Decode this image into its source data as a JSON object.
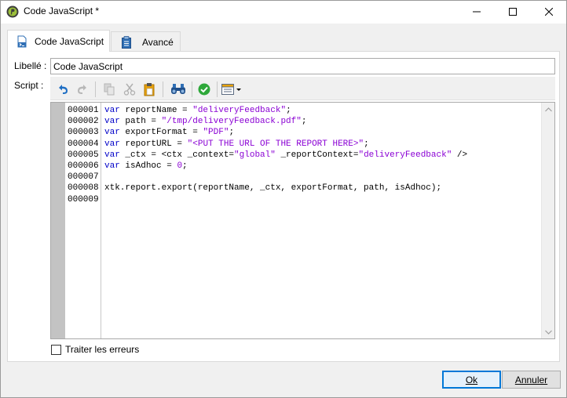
{
  "window": {
    "title": "Code JavaScript *"
  },
  "tabs": [
    {
      "label": "Code JavaScript",
      "icon": "script-icon",
      "active": true
    },
    {
      "label": "Avancé",
      "icon": "clipboard-icon",
      "active": false
    }
  ],
  "form": {
    "libelle_label": "Libellé :",
    "libelle_value": "Code JavaScript",
    "script_label": "Script :"
  },
  "toolbar": {
    "icons": [
      "undo-icon",
      "redo-icon",
      "copy-icon",
      "cut-icon",
      "paste-icon",
      "find-icon",
      "check-syntax-icon",
      "insert-field-icon"
    ]
  },
  "editor": {
    "line_numbers": [
      "000001",
      "000002",
      "000003",
      "000004",
      "000005",
      "000006",
      "000007",
      "000008",
      "000009"
    ],
    "lines": [
      [
        {
          "t": "var",
          "c": "kw"
        },
        {
          "t": " reportName = ",
          "c": "pl"
        },
        {
          "t": "\"deliveryFeedback\"",
          "c": "str"
        },
        {
          "t": ";",
          "c": "pl"
        }
      ],
      [
        {
          "t": "var",
          "c": "kw"
        },
        {
          "t": " path = ",
          "c": "pl"
        },
        {
          "t": "\"/tmp/deliveryFeedback.pdf\"",
          "c": "str"
        },
        {
          "t": ";",
          "c": "pl"
        }
      ],
      [
        {
          "t": "var",
          "c": "kw"
        },
        {
          "t": " exportFormat = ",
          "c": "pl"
        },
        {
          "t": "\"PDF\"",
          "c": "str"
        },
        {
          "t": ";",
          "c": "pl"
        }
      ],
      [
        {
          "t": "var",
          "c": "kw"
        },
        {
          "t": " reportURL = ",
          "c": "pl"
        },
        {
          "t": "\"<PUT THE URL OF THE REPORT HERE>\"",
          "c": "str"
        },
        {
          "t": ";",
          "c": "pl"
        }
      ],
      [
        {
          "t": "var",
          "c": "kw"
        },
        {
          "t": " _ctx = <ctx _context=",
          "c": "pl"
        },
        {
          "t": "\"global\"",
          "c": "str"
        },
        {
          "t": " _reportContext=",
          "c": "pl"
        },
        {
          "t": "\"deliveryFeedback\"",
          "c": "str"
        },
        {
          "t": " />",
          "c": "pl"
        }
      ],
      [
        {
          "t": "var",
          "c": "kw"
        },
        {
          "t": " isAdhoc = ",
          "c": "pl"
        },
        {
          "t": "0",
          "c": "str"
        },
        {
          "t": ";",
          "c": "pl"
        }
      ],
      [],
      [
        {
          "t": "xtk.report.export(reportName, _ctx, exportFormat, path, isAdhoc);",
          "c": "pl"
        }
      ],
      []
    ]
  },
  "options": {
    "handle_errors_label": "Traiter les erreurs",
    "handle_errors_checked": false
  },
  "buttons": {
    "ok_label": "Ok",
    "cancel_label": "Annuler"
  },
  "colors": {
    "keyword": "#0000c8",
    "string": "#8a00d4",
    "accent": "#0078d7"
  }
}
